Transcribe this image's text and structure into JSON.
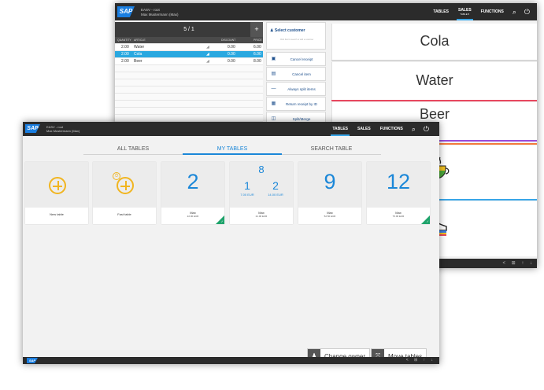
{
  "back_window": {
    "header": {
      "logo": "SAP",
      "user_line1": "EASV - root",
      "user_line2": "Max Mustermann (Max)",
      "nav": [
        {
          "label": "TABLES",
          "sub": ""
        },
        {
          "label": "SALES",
          "sub": "TABLE 5"
        },
        {
          "label": "FUNCTIONS",
          "sub": ""
        }
      ],
      "search_icon": "🔍",
      "power_icon": "⏻"
    },
    "receipt": {
      "title": "5 / 1",
      "add_label": "+",
      "columns": {
        "quantity": "QUANTITY",
        "article": "ARTICLE",
        "discount": "DISCOUNT",
        "price": "PRICE"
      },
      "items": [
        {
          "qty": "2.00",
          "name": "Water",
          "discount": "0.00",
          "price": "6.00"
        },
        {
          "qty": "2.00",
          "name": "Cola",
          "discount": "0.00",
          "price": "6.00"
        },
        {
          "qty": "2.00",
          "name": "Beer",
          "discount": "0.00",
          "price": "8.00"
        }
      ]
    },
    "customer": {
      "title": "Select customer",
      "subtitle": "Click field to search or add a customer"
    },
    "actions": [
      {
        "label": "Cancel receipt",
        "icon": "▣"
      },
      {
        "label": "Cancel item",
        "icon": "▤"
      },
      {
        "label": "Always split items",
        "icon": "—"
      },
      {
        "label": "Return receipt by ID",
        "icon": "▦"
      },
      {
        "label": "Split/Merge",
        "icon": "◫"
      }
    ],
    "products": [
      "Cola",
      "Water",
      "Beer"
    ],
    "product_colors": [
      "#d6d6d6",
      "#e8475f",
      "#9b4ad8"
    ],
    "category_colors": [
      "#f37a3a",
      "#3aa6e8"
    ],
    "footer_icons": "< ⊞ ↑ ↓"
  },
  "front_window": {
    "header": {
      "logo": "SAP",
      "user_line1": "EASV - root",
      "user_line2": "Max Mustermann (Max)",
      "nav": [
        {
          "label": "TABLES"
        },
        {
          "label": "SALES"
        },
        {
          "label": "FUNCTIONS"
        }
      ],
      "search_icon": "🔍",
      "power_icon": "⏻"
    },
    "tabs": [
      "ALL TABLES",
      "MY TABLES",
      "SEARCH TABLE"
    ],
    "tiles": [
      {
        "label": "New table"
      },
      {
        "label": "Fast table"
      },
      {
        "number": "2",
        "owner": "Max",
        "amount": "22.00 EUR"
      },
      {
        "number": "8",
        "subs": [
          {
            "n": "1",
            "a": "7.00 EUR"
          },
          {
            "n": "2",
            "a": "14.00 EUR"
          }
        ],
        "owner": "Max",
        "amount": "21.00 EUR"
      },
      {
        "number": "9",
        "owner": "Max",
        "amount": "52.50 EUR"
      },
      {
        "number": "12",
        "owner": "Max",
        "amount": "76.00 EUR"
      }
    ],
    "buttons": {
      "change_owner": "Change owner",
      "move_tables": "Move tables"
    },
    "footer_logo": "SAP",
    "footer_icons": "< ⊞ ↑ ↓"
  }
}
